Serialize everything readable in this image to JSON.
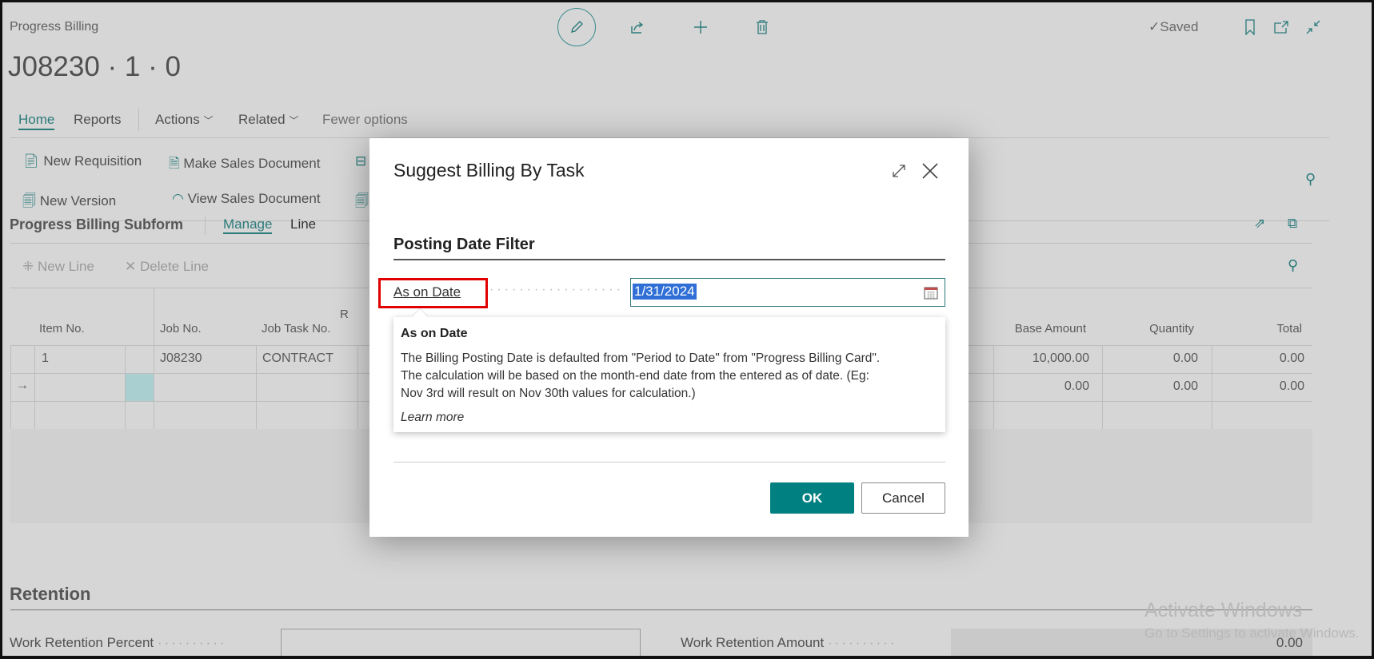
{
  "header": {
    "breadcrumb": "Progress Billing",
    "title": "J08230 · 1 · 0",
    "saved_label": "Saved"
  },
  "icons": {
    "edit": "pencil-icon",
    "share": "share-icon",
    "new": "plus-icon",
    "delete": "trash-icon",
    "bookmark": "bookmark-icon",
    "open_new": "open-new-window-icon",
    "collapse": "collapse-icon"
  },
  "tabs": [
    {
      "label": "Home",
      "active": true
    },
    {
      "label": "Reports"
    },
    {
      "label": "Actions"
    },
    {
      "label": "Related"
    },
    {
      "label": "Fewer options"
    }
  ],
  "actions": {
    "new_requisition": "New Requisition",
    "make_sales_document": "Make Sales Document",
    "new_version": "New Version",
    "view_sales_document": "View Sales Document"
  },
  "subform": {
    "title": "Progress Billing Subform",
    "tabs": [
      "Manage",
      "Line"
    ],
    "new_line": "New Line",
    "delete_line": "Delete Line",
    "columns": {
      "item_no": "Item No.",
      "job_no": "Job No.",
      "job_task_no": "Job Task No.",
      "partial": "R",
      "base_amount": "Base Amount",
      "quantity": "Quantity",
      "total": "Total"
    },
    "rows": [
      {
        "item_no": "1",
        "job_no": "J08230",
        "job_task_no": "CONTRACT",
        "base_amount": "10,000.00",
        "quantity": "0.00",
        "total": "0.00"
      },
      {
        "item_no": "",
        "job_no": "",
        "job_task_no": "",
        "base_amount": "0.00",
        "quantity": "0.00",
        "total": "0.00",
        "current": true
      }
    ]
  },
  "retention": {
    "title": "Retention",
    "work_retention_percent_label": "Work Retention Percent",
    "work_retention_percent": "",
    "work_retention_amount_label": "Work Retention Amount",
    "work_retention_amount": "0.00"
  },
  "watermark": {
    "line1": "Activate Windows",
    "line2": "Go to Settings to activate Windows."
  },
  "dialog": {
    "title": "Suggest Billing By Task",
    "section": "Posting Date Filter",
    "field_label": "As on Date",
    "field_value": "1/31/2024",
    "tooltip": {
      "title": "As on Date",
      "lines": [
        "The Billing Posting Date is defaulted from \"Period to Date\" from \"Progress Billing Card\".",
        "The calculation will be based on the month-end date from the entered as of date. (Eg:",
        "Nov 3rd will result on Nov 30th values for calculation.)"
      ],
      "link": "Learn more"
    },
    "ok": "OK",
    "cancel": "Cancel"
  },
  "colors": {
    "accent": "#008080",
    "highlight": "#ff0000",
    "selection": "#2f6fd6"
  }
}
